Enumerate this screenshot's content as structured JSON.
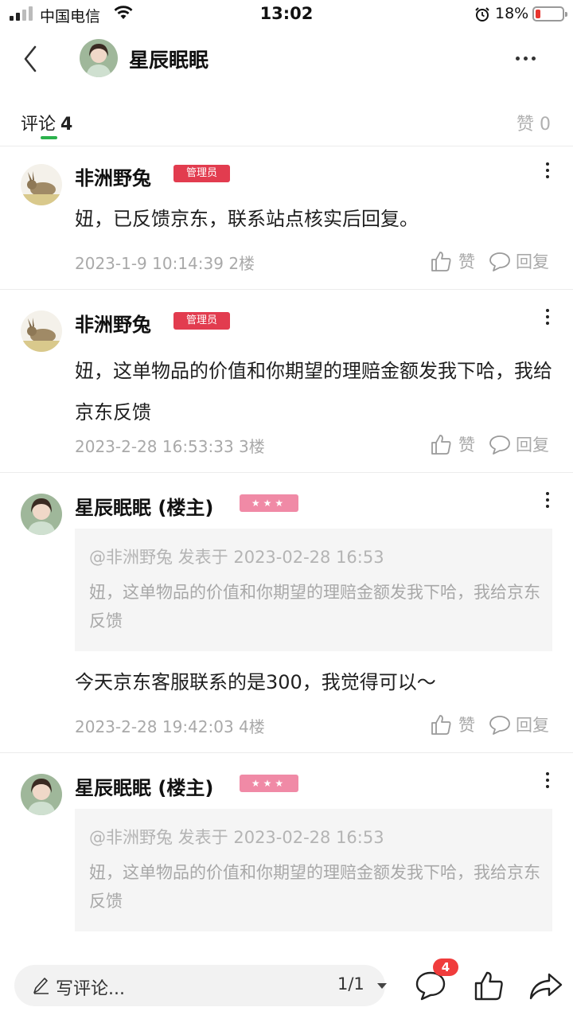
{
  "status_bar": {
    "carrier": "中国电信",
    "time": "13:02",
    "battery": "18%",
    "battery_level": 0.18,
    "icons": [
      "signal-icon",
      "wifi-icon",
      "alarm-icon",
      "battery-icon"
    ]
  },
  "header": {
    "title": "星辰眠眠",
    "icons": [
      "back-icon",
      "more-icon"
    ]
  },
  "tabs": {
    "comments_label": "评论",
    "comments_count": "4",
    "likes_label": "赞 0"
  },
  "comments": [
    {
      "name": "非洲野兔",
      "badge": "管理员",
      "text": "妞，已反馈京东，联系站点核实后回复。",
      "meta": "2023-1-9 10:14:39  2楼",
      "like_label": "赞",
      "reply_label": "回复"
    },
    {
      "name": "非洲野兔",
      "badge": "管理员",
      "text": "妞，这单物品的价值和你期望的理赔金额发我下哈，我给京东反馈",
      "meta": "2023-2-28 16:53:33  3楼",
      "like_label": "赞",
      "reply_label": "回复"
    },
    {
      "name": "星辰眠眠 (楼主)",
      "badge_stars": "★★★",
      "quote_head": "@非洲野兔 发表于 2023-02-28 16:53",
      "quote_text": "妞，这单物品的价值和你期望的理赔金额发我下哈，我给京东反馈",
      "text": "今天京东客服联系的是300，我觉得可以～",
      "meta": "2023-2-28 19:42:03  4楼",
      "like_label": "赞",
      "reply_label": "回复"
    },
    {
      "name": "星辰眠眠 (楼主)",
      "badge_stars": "★★★",
      "quote_head": "@非洲野兔 发表于 2023-02-28 16:53",
      "quote_text": "妞，这单物品的价值和你期望的理赔金额发我下哈，我给京东反馈"
    }
  ],
  "bottom_bar": {
    "write_label": "写评论...",
    "page_indicator": "1/1",
    "comment_count": "4",
    "icons": [
      "pencil-icon",
      "comment-icon",
      "thumbs-up-icon",
      "share-icon"
    ]
  },
  "colors": {
    "accent_green": "#2bb24c",
    "admin_badge": "#e23c4f",
    "stars_badge": "#f08aa6",
    "notification_red": "#f03c3c"
  }
}
